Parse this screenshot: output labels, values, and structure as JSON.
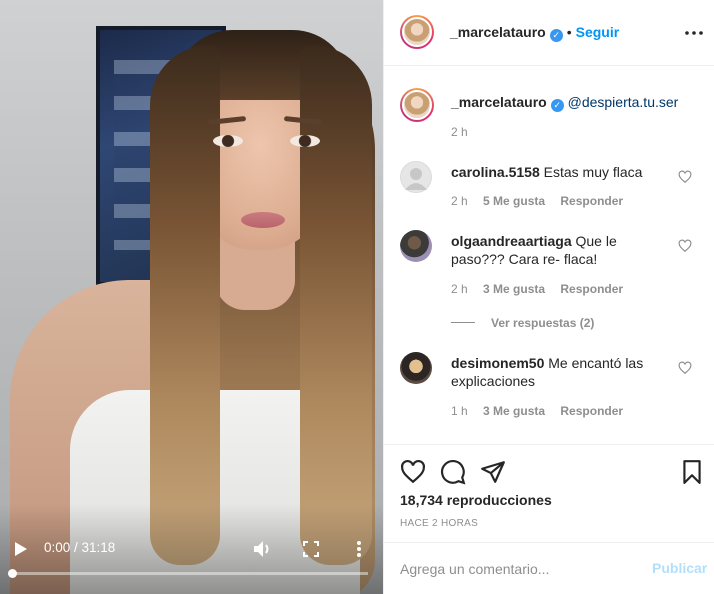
{
  "video": {
    "time_display": "0:00 / 31:18",
    "progress_fraction": 0.0,
    "icons": {
      "play": "play-icon",
      "volume": "volume-icon",
      "fullscreen": "fullscreen-icon",
      "more": "more-vertical-icon"
    }
  },
  "header": {
    "username": "_marcelatauro",
    "separator": "•",
    "follow_label": "Seguir",
    "more_icon": "more-horizontal-icon"
  },
  "caption": {
    "username": "_marcelatauro",
    "text": "@despierta.tu.ser",
    "time": "2 h"
  },
  "comments": [
    {
      "username": "carolina.5158",
      "text": "Estas muy flaca",
      "time": "2 h",
      "likes": "5 Me gusta",
      "reply_label": "Responder"
    },
    {
      "username": "olgaandreaartiaga",
      "text": "Que le paso??? Cara re- flaca!",
      "time": "2 h",
      "likes": "3 Me gusta",
      "reply_label": "Responder",
      "view_replies": "Ver respuestas (2)"
    },
    {
      "username": "desimonem50",
      "text": "Me encantó las explicaciones",
      "time": "1 h",
      "likes": "3 Me gusta",
      "reply_label": "Responder"
    }
  ],
  "actions": {
    "icons": [
      "heart-icon",
      "comment-icon",
      "share-icon",
      "bookmark-icon"
    ],
    "views": "18,734 reproducciones",
    "posted_ago": "HACE 2 HORAS"
  },
  "composer": {
    "placeholder": "Agrega un comentario...",
    "post_label": "Publicar"
  },
  "colors": {
    "accent": "#0095f6",
    "verified": "#3897f0",
    "muted": "#8e8e8e",
    "post_disabled": "#b2dffc"
  }
}
